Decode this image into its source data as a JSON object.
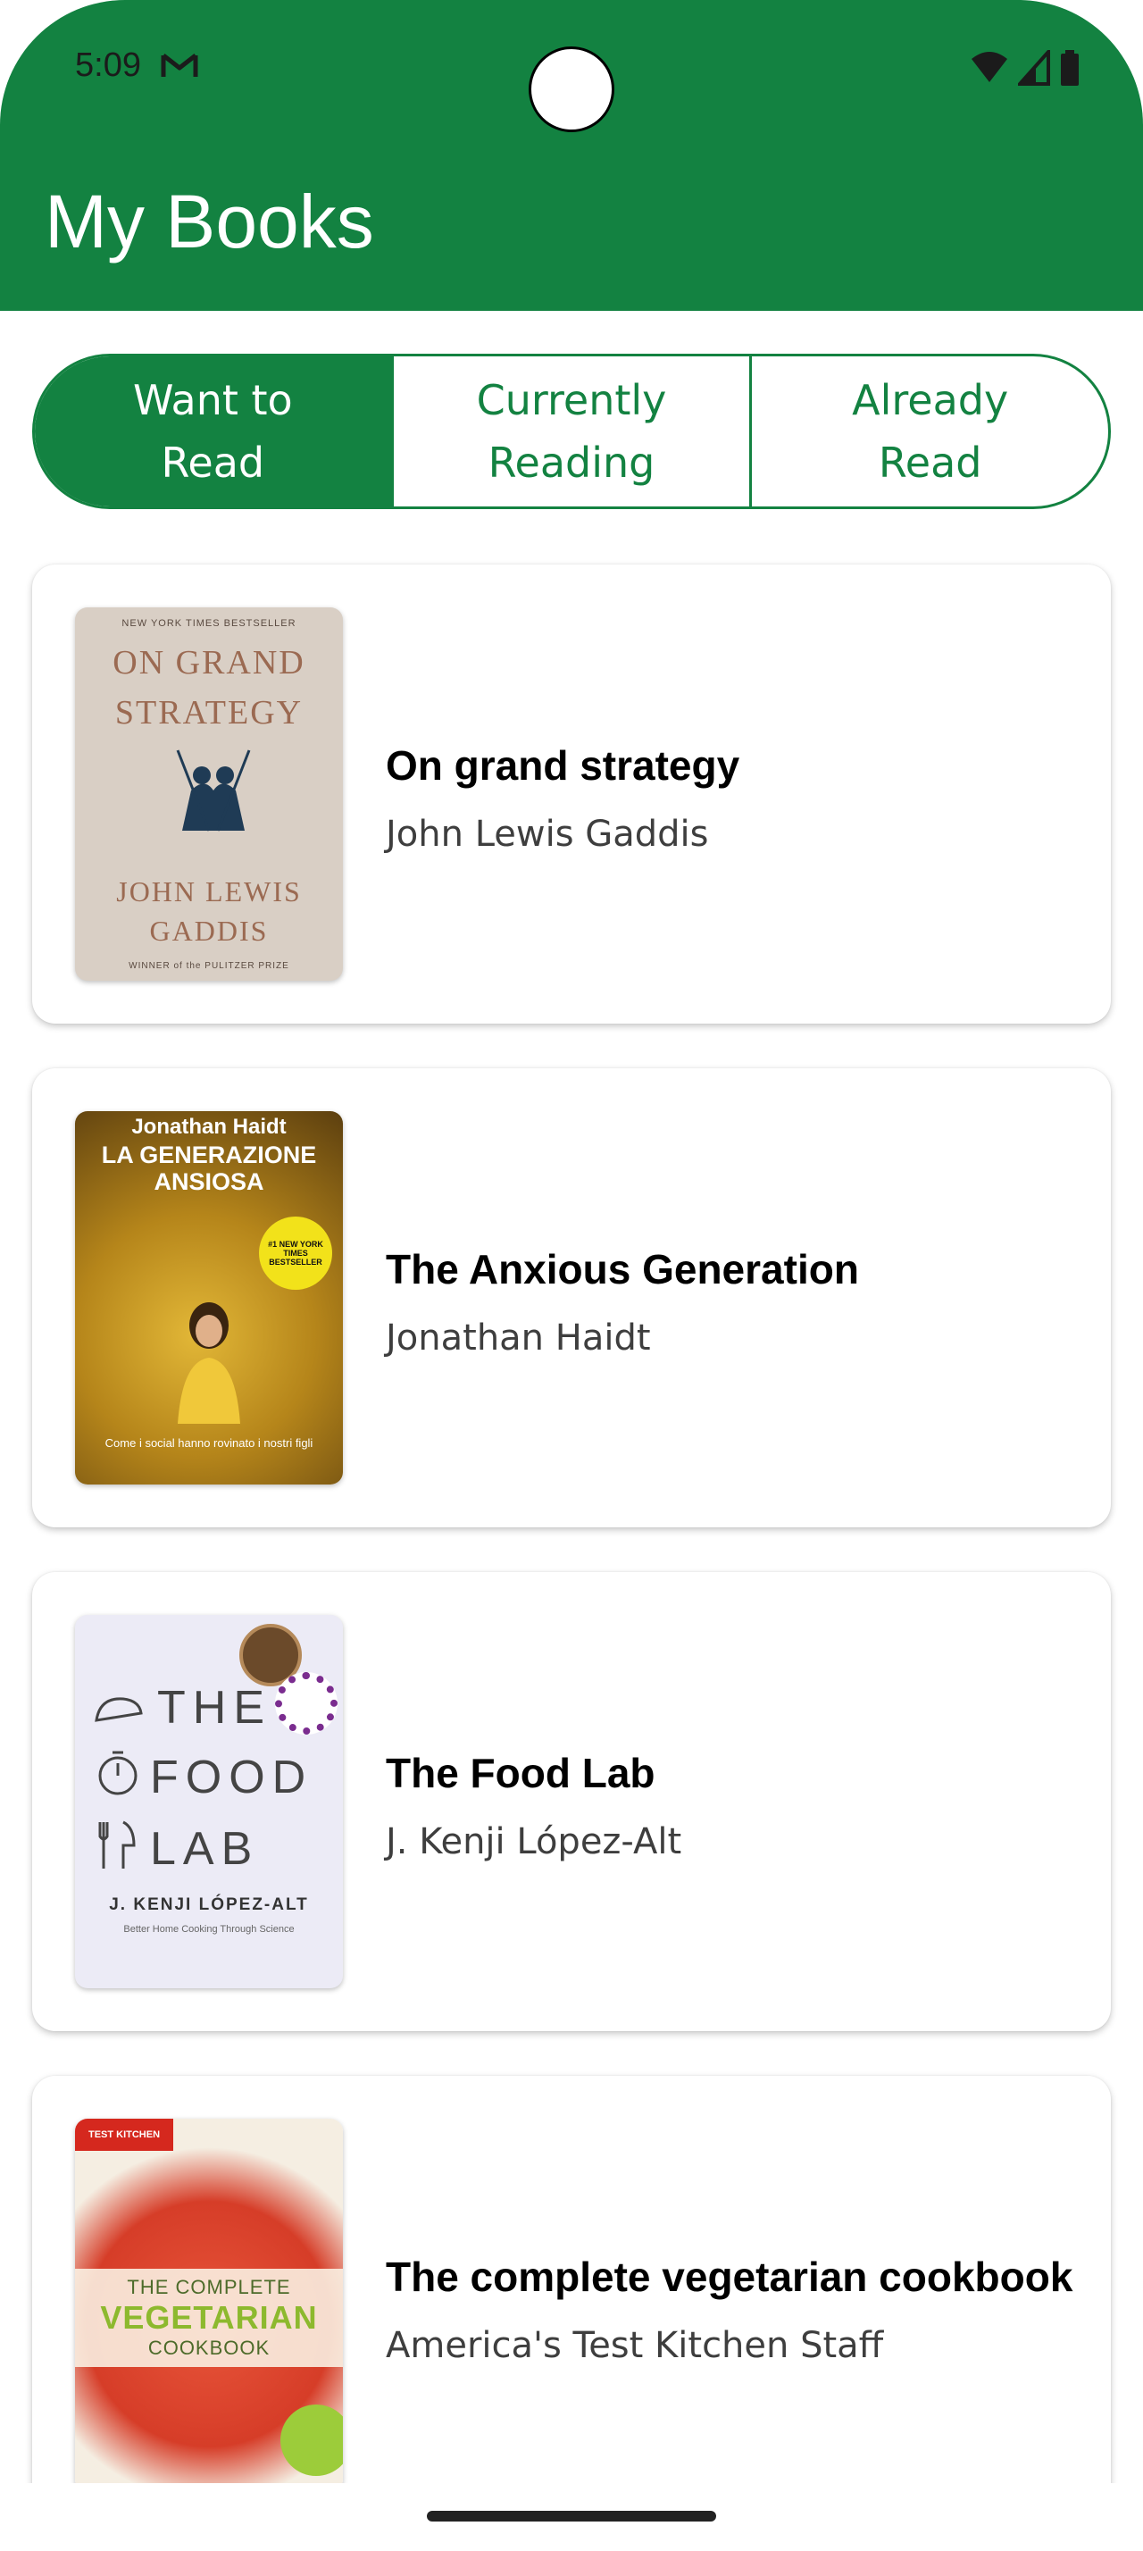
{
  "status_bar": {
    "time": "5:09"
  },
  "header": {
    "title": "My Books"
  },
  "tabs": [
    {
      "label": "Want to\nRead",
      "active": true
    },
    {
      "label": "Currently\nReading",
      "active": false
    },
    {
      "label": "Already\nRead",
      "active": false
    }
  ],
  "books": [
    {
      "title": "On grand strategy",
      "author": "John Lewis Gaddis",
      "cover": {
        "top": "NEW YORK TIMES BESTSELLER",
        "line1": "ON GRAND",
        "line2": "STRATEGY",
        "line3": "JOHN LEWIS",
        "line4": "GADDIS",
        "bottom": "WINNER of the PULITZER PRIZE"
      }
    },
    {
      "title": "The Anxious Generation",
      "author": "Jonathan Haidt",
      "cover": {
        "author": "Jonathan Haidt",
        "line1": "LA GENERAZIONE",
        "line2": "ANSIOSA",
        "badge": "#1 NEW YORK TIMES BESTSELLER",
        "bottom": "Come i social hanno rovinato i nostri figli"
      }
    },
    {
      "title": "The Food Lab",
      "author": "J. Kenji López-Alt",
      "cover": {
        "line1": "THE",
        "line2": "FOOD",
        "line3": "LAB",
        "author": "J. KENJI LÓPEZ-ALT",
        "subtitle": "Better Home Cooking Through Science"
      }
    },
    {
      "title": "The complete vegetarian cookbook",
      "author": "America's Test Kitchen Staff",
      "cover": {
        "brand": "TEST KITCHEN",
        "line1": "THE COMPLETE",
        "line2": "VEGETARIAN",
        "line3": "COOKBOOK"
      }
    }
  ],
  "colors": {
    "primary": "#138241",
    "surface": "#ffffff"
  }
}
